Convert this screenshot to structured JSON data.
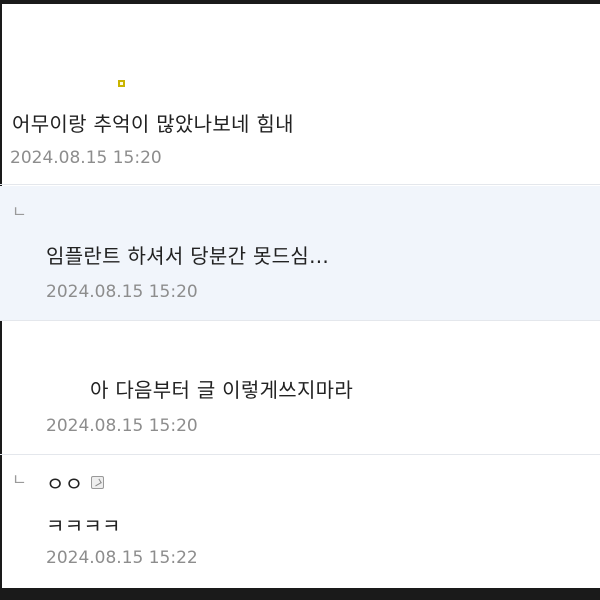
{
  "comments": [
    {
      "text": "어무이랑 추억이 많았나보네 힘내",
      "date": "2024.08.15 15:20"
    },
    {
      "reply_marker": "ㄴ",
      "text": "임플란트 하셔서 당분간 못드심...",
      "date": "2024.08.15 15:20"
    },
    {
      "text": "아 다음부터 글 이렇게쓰지마라",
      "date": "2024.08.15 15:20"
    },
    {
      "reply_marker": "ㄴ",
      "text": "ㅇㅇ",
      "icon": "sticker-icon",
      "text2": "ㅋㅋㅋㅋ",
      "date": "2024.08.15 15:22"
    }
  ],
  "colors": {
    "reply_background": "#f1f5fb",
    "date_text": "#8d8d8d",
    "frame": "#1a1a1a"
  }
}
